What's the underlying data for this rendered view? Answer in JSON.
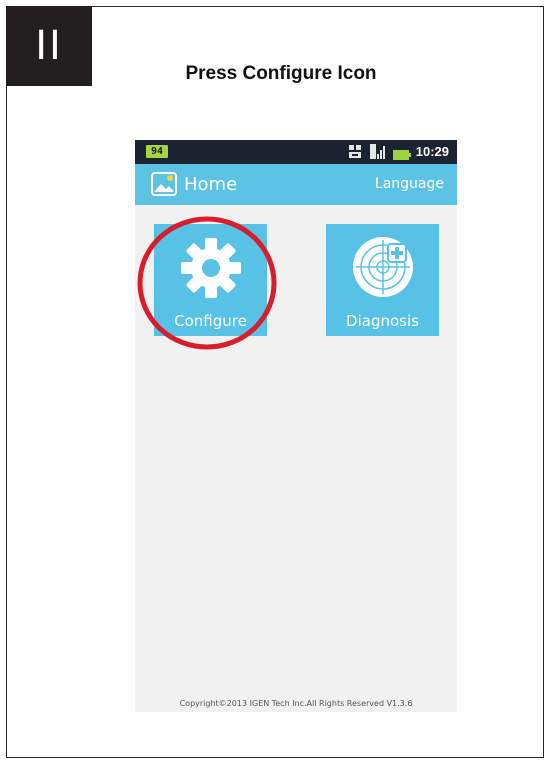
{
  "step": {
    "number": "II"
  },
  "instruction": {
    "text": "Press Configure Icon"
  },
  "phone": {
    "status_bar": {
      "battery": "94",
      "time": "10:29"
    },
    "app_bar": {
      "title": "Home",
      "language_label": "Language",
      "logo_icon": "picture-icon"
    },
    "tiles": [
      {
        "label": "Configure",
        "icon": "gear-icon"
      },
      {
        "label": "Diagnosis",
        "icon": "target-cross-icon"
      }
    ],
    "copyright": "Copyright©2013 IGEN Tech Inc.All Rights Reserved V1.3.6"
  },
  "colors": {
    "app_bar": "#5dc3e5",
    "tile": "#58c2e6",
    "status_bar": "#1b2230",
    "battery": "#a5d445",
    "highlight": "#d81e2c"
  }
}
